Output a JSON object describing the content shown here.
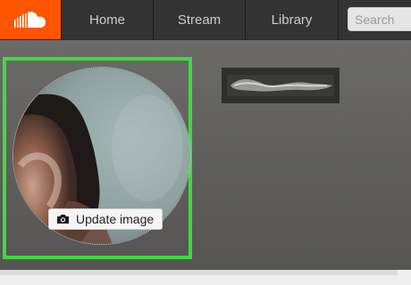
{
  "nav": {
    "logo": "soundcloud-logo",
    "items": [
      {
        "label": "Home"
      },
      {
        "label": "Stream"
      },
      {
        "label": "Library"
      }
    ],
    "search_placeholder": "Search"
  },
  "profile": {
    "update_image_label": "Update image",
    "update_image_icon": "camera-icon"
  },
  "colors": {
    "brand": "#ff5500",
    "topbar": "#333333",
    "highlight": "#3ddc3d"
  }
}
